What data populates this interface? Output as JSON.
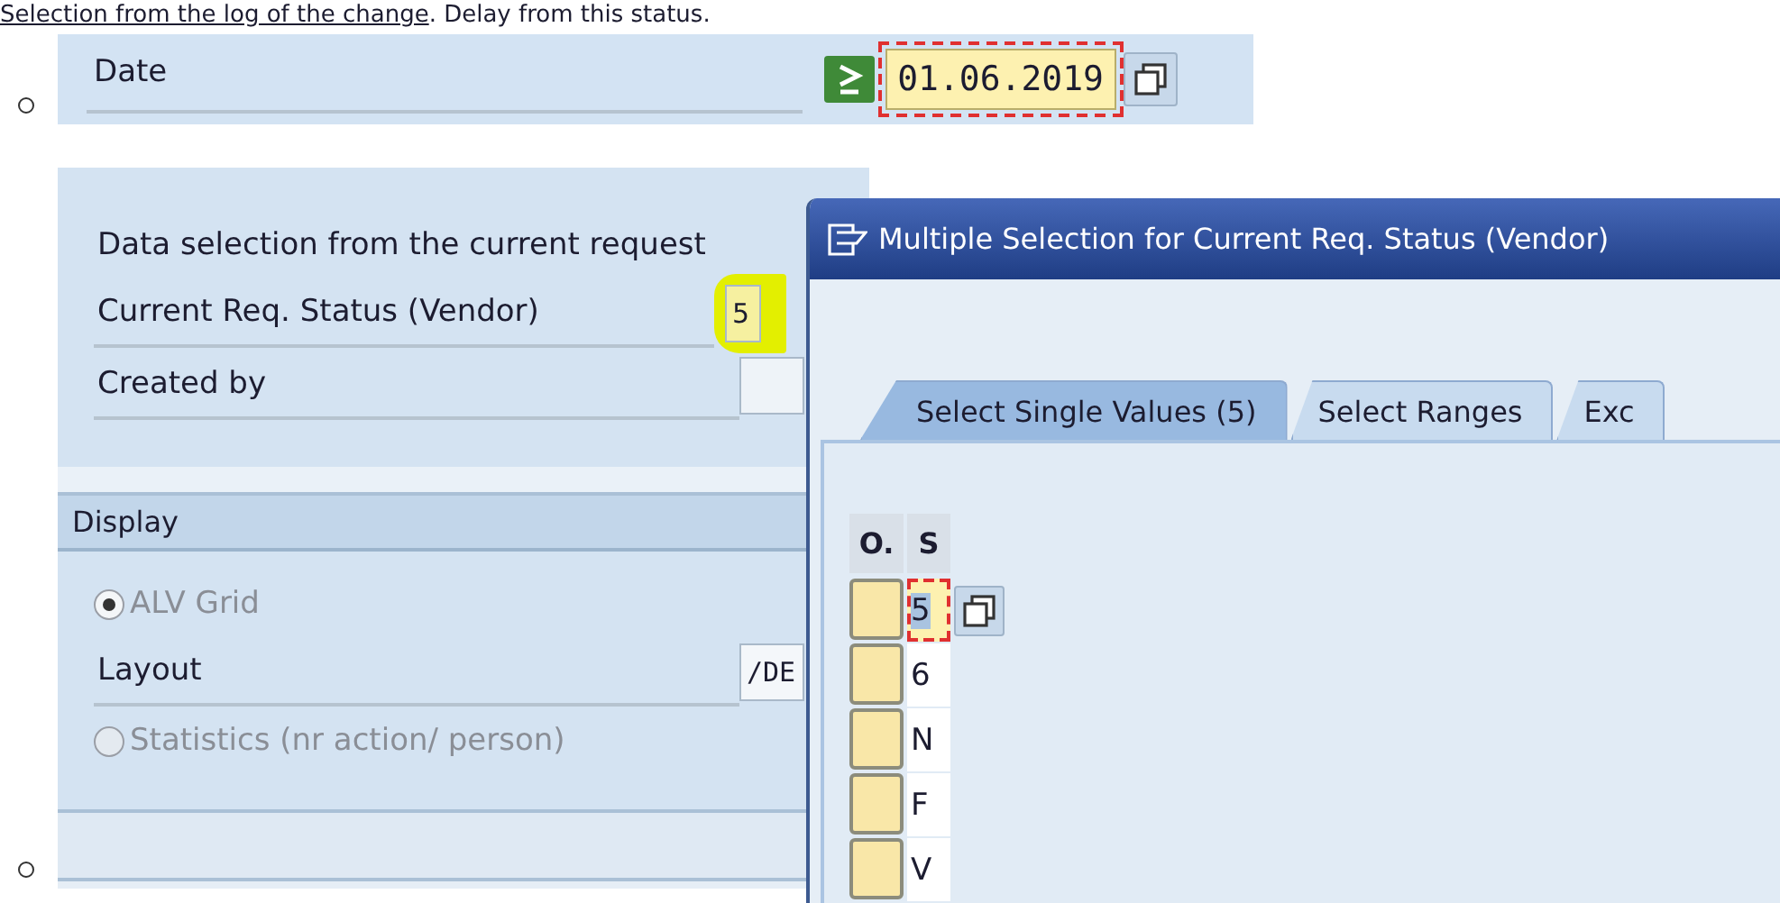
{
  "intro": {
    "link": "Selection from the log of the change",
    "text": ". Delay from this status."
  },
  "date_filter": {
    "label": "Date",
    "value": "01.06.2019"
  },
  "selection": {
    "heading": "Data selection from the current request",
    "fields": [
      {
        "label": "Current Req. Status (Vendor)",
        "value": "5",
        "highlighted": true
      },
      {
        "label": "Created by",
        "highlighted": false
      }
    ]
  },
  "display": {
    "title": "Display",
    "options": [
      {
        "kind": "radio",
        "label": "ALV Grid",
        "selected": true,
        "disabled": true
      },
      {
        "kind": "field",
        "label": "Layout",
        "value": "/DE"
      },
      {
        "kind": "radio",
        "label": "Statistics (nr action/ person)",
        "selected": false,
        "disabled": true
      }
    ]
  },
  "dialog": {
    "title": "Multiple Selection for Current Req. Status (Vendor)",
    "tabs": [
      {
        "label": "Select Single Values (5)",
        "selected": true
      },
      {
        "label": "Select Ranges",
        "selected": false
      },
      {
        "label": "Exc",
        "selected": false
      }
    ],
    "table": {
      "columns": [
        "O.",
        "S"
      ],
      "rows": [
        {
          "value": "5",
          "focused": true
        },
        {
          "value": "6",
          "focused": false
        },
        {
          "value": "N",
          "focused": false
        },
        {
          "value": "F",
          "focused": false
        },
        {
          "value": "V",
          "focused": false
        }
      ]
    }
  }
}
